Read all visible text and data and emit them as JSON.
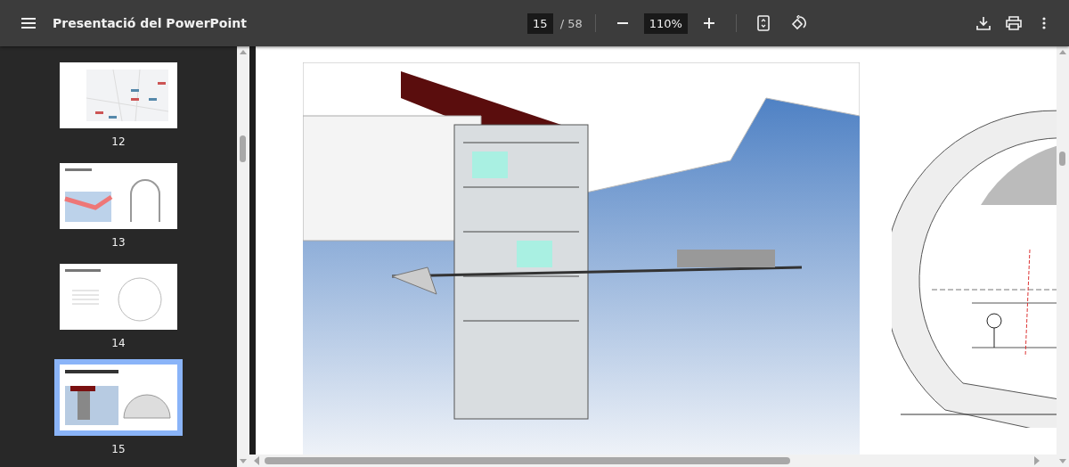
{
  "toolbar": {
    "title": "Presentació del PowerPoint",
    "page_input": "15",
    "page_total": "/ 58",
    "zoom": "110%"
  },
  "thumbnails": [
    {
      "label": "12",
      "kind": "map",
      "selected": false
    },
    {
      "label": "13",
      "kind": "tunnel",
      "selected": false
    },
    {
      "label": "14",
      "kind": "section",
      "selected": false
    },
    {
      "label": "15",
      "kind": "render",
      "selected": true
    }
  ]
}
